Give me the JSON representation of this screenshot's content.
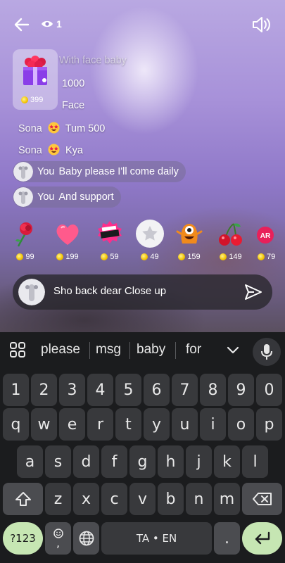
{
  "header": {
    "viewer_count": "1",
    "icons": [
      "back-arrow-icon",
      "eye-icon",
      "speaker-icon"
    ]
  },
  "gift_card": {
    "price": "399",
    "icon": "gift-box-icon"
  },
  "chat": {
    "lines": [
      {
        "name": "",
        "text": "With face baby"
      },
      {
        "name": "",
        "text": "1000"
      },
      {
        "name": "",
        "text": "Face"
      },
      {
        "name": "Sona",
        "text": "Tum 500",
        "emoji": "star-struck-emoji"
      },
      {
        "name": "Sona",
        "text": "Kya",
        "emoji": "star-struck-emoji"
      }
    ],
    "own_messages": [
      {
        "name": "You",
        "text": "Baby please I'll come daily"
      },
      {
        "name": "You",
        "text": "And support"
      }
    ]
  },
  "gifts": [
    {
      "icon": "rose-icon",
      "price": "99"
    },
    {
      "icon": "heart-icon",
      "price": "199"
    },
    {
      "icon": "girl-pwr-sticker-icon",
      "price": "59"
    },
    {
      "icon": "star-icon",
      "price": "49"
    },
    {
      "icon": "monster-icon",
      "price": "159"
    },
    {
      "icon": "cherry-icon",
      "price": "149"
    },
    {
      "icon": "ar-gift-icon",
      "label": "AR",
      "price": "79"
    }
  ],
  "comment": {
    "text": "Sho back dear Close up",
    "send_icon": "send-icon"
  },
  "keyboard": {
    "suggestions": [
      "please",
      "msg",
      "baby",
      "for"
    ],
    "row_numbers": [
      "1",
      "2",
      "3",
      "4",
      "5",
      "6",
      "7",
      "8",
      "9",
      "0"
    ],
    "row1": [
      "q",
      "w",
      "e",
      "r",
      "t",
      "y",
      "u",
      "i",
      "o",
      "p"
    ],
    "row2": [
      "a",
      "s",
      "d",
      "f",
      "g",
      "h",
      "j",
      "k",
      "l"
    ],
    "row3": [
      "z",
      "x",
      "c",
      "v",
      "b",
      "n",
      "m"
    ],
    "symbols_key": "?123",
    "comma_key": ",",
    "space_label": "TA • EN",
    "period_key": ".",
    "colors": {
      "accent_green": "#c6e6b3",
      "key_bg": "#38393c",
      "fn_key_bg": "#4b4c50"
    }
  }
}
